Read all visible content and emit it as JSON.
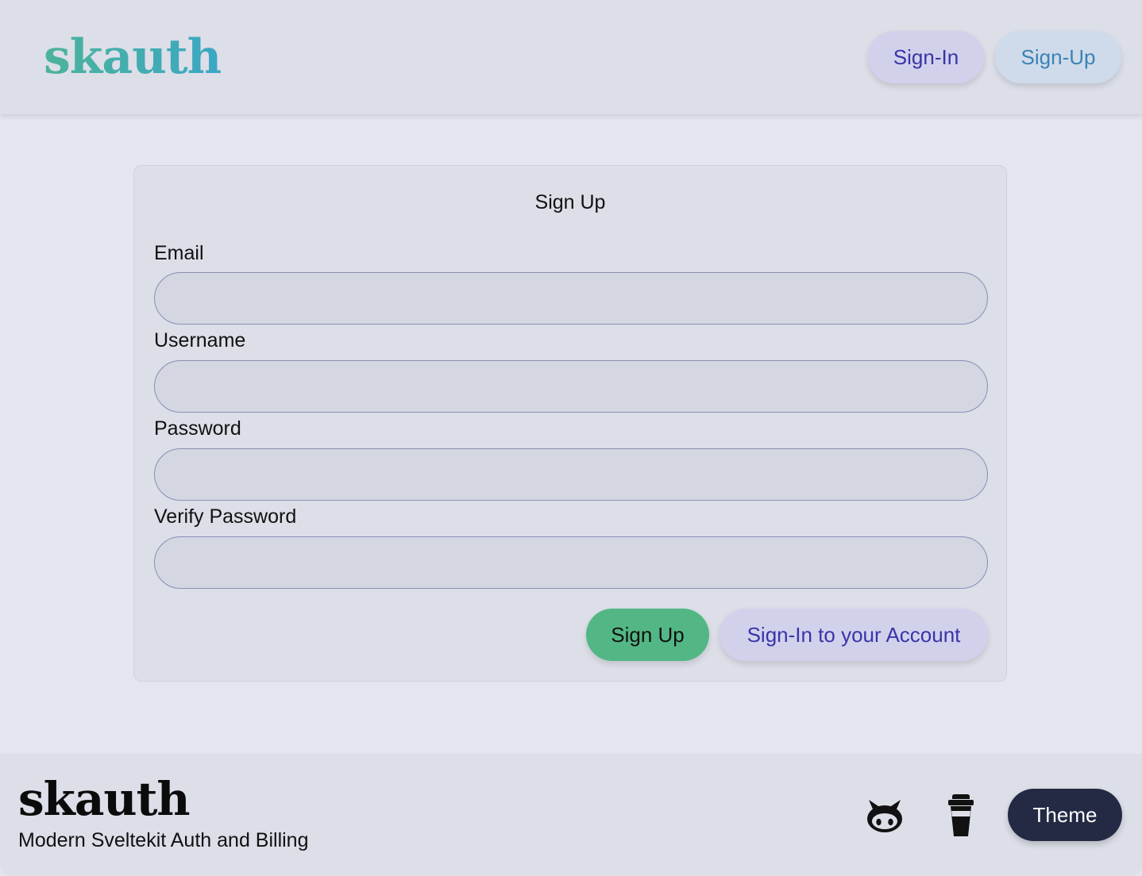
{
  "header": {
    "logo": "skauth",
    "signin_label": "Sign-In",
    "signup_label": "Sign-Up"
  },
  "form": {
    "title": "Sign Up",
    "fields": [
      {
        "label": "Email",
        "value": "",
        "placeholder": ""
      },
      {
        "label": "Username",
        "value": "",
        "placeholder": ""
      },
      {
        "label": "Password",
        "value": "",
        "placeholder": ""
      },
      {
        "label": "Verify Password",
        "value": "",
        "placeholder": ""
      }
    ],
    "submit_label": "Sign Up",
    "alt_label": "Sign-In to your Account"
  },
  "footer": {
    "logo": "skauth",
    "tagline": "Modern Sveltekit Auth and Billing",
    "icons": [
      "github-icon",
      "coffee-cup-icon"
    ],
    "theme_label": "Theme"
  },
  "colors": {
    "accent_green": "#52b784",
    "accent_indigo": "#3a34a8",
    "theme_button": "#242944"
  }
}
